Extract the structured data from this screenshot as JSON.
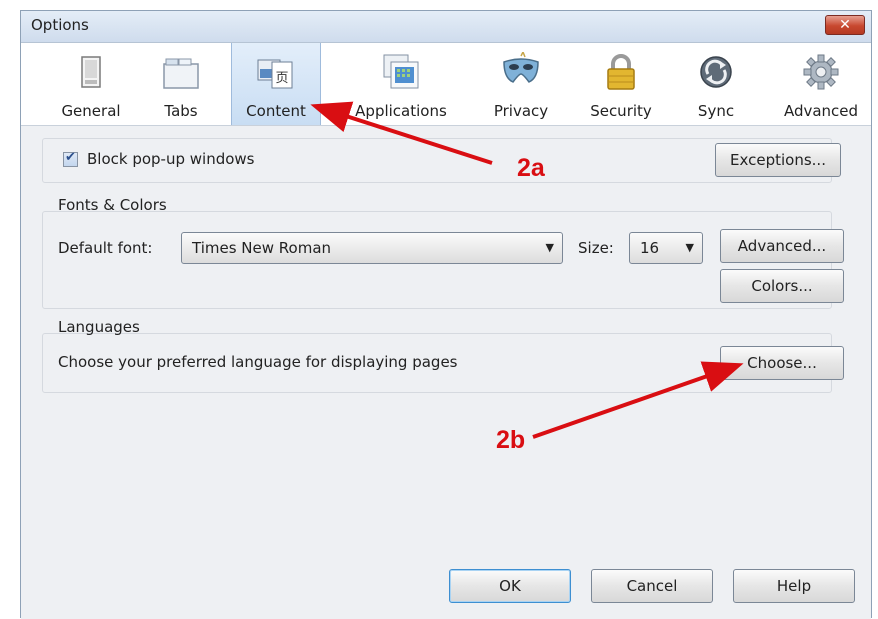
{
  "window": {
    "title": "Options",
    "close_glyph": "✕"
  },
  "toolbar": {
    "items": [
      {
        "label": "General",
        "icon": "general-icon"
      },
      {
        "label": "Tabs",
        "icon": "tabs-icon"
      },
      {
        "label": "Content",
        "icon": "content-icon",
        "selected": true
      },
      {
        "label": "Applications",
        "icon": "applications-icon"
      },
      {
        "label": "Privacy",
        "icon": "privacy-mask-icon"
      },
      {
        "label": "Security",
        "icon": "padlock-icon"
      },
      {
        "label": "Sync",
        "icon": "sync-icon"
      },
      {
        "label": "Advanced",
        "icon": "gear-icon"
      }
    ]
  },
  "popup": {
    "label": "Block pop-up windows",
    "checked": true,
    "exceptions_label": "Exceptions..."
  },
  "fonts": {
    "group_title": "Fonts & Colors",
    "default_font_label": "Default font:",
    "default_font_value": "Times New Roman",
    "size_label": "Size:",
    "size_value": "16",
    "advanced_label": "Advanced...",
    "colors_label": "Colors..."
  },
  "languages": {
    "group_title": "Languages",
    "description": "Choose your preferred language for displaying pages",
    "choose_label": "Choose..."
  },
  "footer": {
    "ok_label": "OK",
    "cancel_label": "Cancel",
    "help_label": "Help"
  },
  "annotations": {
    "a": "2a",
    "b": "2b",
    "color": "#d90e12"
  },
  "colors": {
    "selected_tab": "#c8ddf3",
    "background": "#eef0f3",
    "default_button_border": "#3d8fd1"
  }
}
